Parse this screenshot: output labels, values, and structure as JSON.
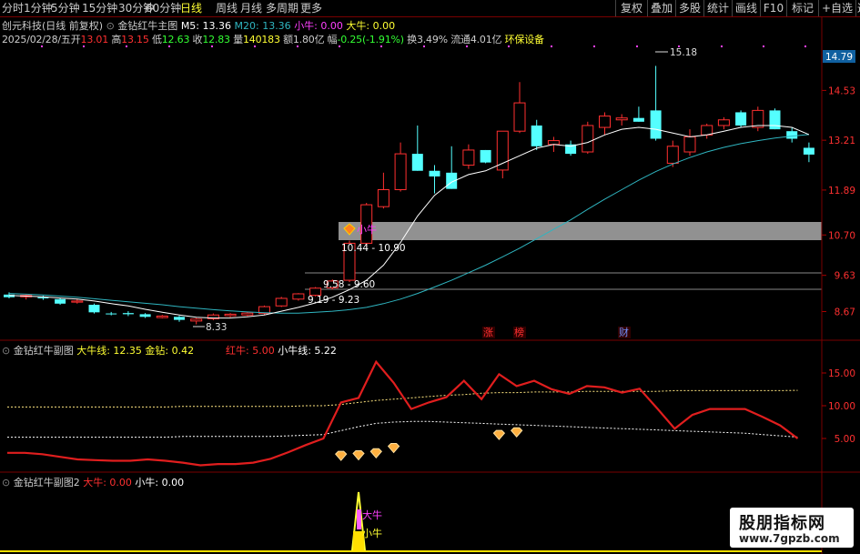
{
  "toolbar": {
    "periods": [
      "分时",
      "1分钟",
      "5分钟",
      "15分钟",
      "30分钟",
      "60分钟",
      "日线",
      "周线",
      "月线",
      "多周期",
      "更多"
    ],
    "active_period": "日线",
    "right_buttons": [
      "复权",
      "叠加",
      "多股",
      "统计",
      "画线",
      "F10",
      "标记",
      "+自选",
      "返回"
    ]
  },
  "main_header": {
    "stock": "创元科技(日线 前复权)",
    "indicator": "金钻红牛主图",
    "m5": "M5: 13.36",
    "m20": "M20: 13.36",
    "xiaoniu": "小牛: 0.00",
    "daniu": "大牛: 0.00"
  },
  "quote_line": {
    "date": "2025/02/28/五",
    "open_label": "开",
    "open": "13.01",
    "high_label": "高",
    "high": "13.15",
    "low_label": "低",
    "low": "12.63",
    "close_label": "收",
    "close": "12.83",
    "vol_label": "量",
    "vol": "140183",
    "amt_label": "额",
    "amt": "1.80亿",
    "chg_label": "幅",
    "chg": "-0.25(-1.91%)",
    "turn_label": "换",
    "turn": "3.49%",
    "float_label": "流通",
    "float": "4.01亿",
    "sector": "环保设备"
  },
  "sub1_header": {
    "name": "金钻红牛副图",
    "daniuxian": "大牛线: 12.35",
    "jinzuan": "金钻: 0.42",
    "hongniu": "红牛: 5.00",
    "xiaoniuxian": "小牛线: 5.22"
  },
  "sub2_header": {
    "name": "金钻红牛副图2",
    "daniu": "大牛: 0.00",
    "xiaoniu": "小牛: 0.00"
  },
  "annotations": {
    "high_price": "15.18",
    "low_price": "8.33",
    "band_top": "10.44 - 10.90",
    "band_mid": "9.58 - 9.60",
    "band_low": "9.19 - 9.23",
    "xiaoniu_signal": "小牛",
    "sub2_daniu": "大牛",
    "sub2_xiaoniu": "小牛",
    "events": [
      "涨",
      "榜",
      "财"
    ]
  },
  "watermark": {
    "brand": "股朋指标网",
    "url": "www.7gpzb.com"
  },
  "colors": {
    "up": "#ff3030",
    "down": "#54ffff",
    "ma5": "#ffffff",
    "ma20": "#2fb5c0",
    "red_line": "#e01e1e",
    "yellow": "#ffff33",
    "magenta": "#ff40ff"
  },
  "chart_data": [
    {
      "type": "candlestick",
      "title": "金钻红牛主图",
      "ylim": [
        8.2,
        15.6
      ],
      "y_ticks": [
        "14.53",
        "13.21",
        "11.89",
        "10.70",
        "9.63",
        "8.67"
      ],
      "current_price_tag": "14.79",
      "candles": [
        {
          "o": 9.12,
          "h": 9.18,
          "l": 9.02,
          "c": 9.05
        },
        {
          "o": 9.06,
          "h": 9.14,
          "l": 8.99,
          "c": 9.1
        },
        {
          "o": 9.05,
          "h": 9.09,
          "l": 8.98,
          "c": 9.02
        },
        {
          "o": 9.0,
          "h": 9.04,
          "l": 8.85,
          "c": 8.88
        },
        {
          "o": 8.92,
          "h": 9.0,
          "l": 8.88,
          "c": 8.95
        },
        {
          "o": 8.85,
          "h": 8.88,
          "l": 8.62,
          "c": 8.65
        },
        {
          "o": 8.62,
          "h": 8.66,
          "l": 8.57,
          "c": 8.6
        },
        {
          "o": 8.63,
          "h": 8.68,
          "l": 8.55,
          "c": 8.6
        },
        {
          "o": 8.6,
          "h": 8.63,
          "l": 8.5,
          "c": 8.53
        },
        {
          "o": 8.51,
          "h": 8.58,
          "l": 8.49,
          "c": 8.55
        },
        {
          "o": 8.53,
          "h": 8.56,
          "l": 8.4,
          "c": 8.45
        },
        {
          "o": 8.42,
          "h": 8.5,
          "l": 8.33,
          "c": 8.47
        },
        {
          "o": 8.48,
          "h": 8.62,
          "l": 8.44,
          "c": 8.58
        },
        {
          "o": 8.56,
          "h": 8.63,
          "l": 8.52,
          "c": 8.6
        },
        {
          "o": 8.58,
          "h": 8.66,
          "l": 8.55,
          "c": 8.63
        },
        {
          "o": 8.62,
          "h": 8.83,
          "l": 8.58,
          "c": 8.8
        },
        {
          "o": 8.82,
          "h": 9.06,
          "l": 8.79,
          "c": 9.02
        },
        {
          "o": 9.0,
          "h": 9.16,
          "l": 8.96,
          "c": 9.14
        },
        {
          "o": 9.1,
          "h": 9.32,
          "l": 9.07,
          "c": 9.29
        },
        {
          "o": 9.3,
          "h": 9.52,
          "l": 9.25,
          "c": 9.48
        },
        {
          "o": 9.5,
          "h": 10.55,
          "l": 9.45,
          "c": 10.48
        },
        {
          "o": 10.48,
          "h": 11.55,
          "l": 10.4,
          "c": 11.5
        },
        {
          "o": 11.45,
          "h": 12.35,
          "l": 11.4,
          "c": 11.9
        },
        {
          "o": 11.9,
          "h": 13.15,
          "l": 11.85,
          "c": 12.85
        },
        {
          "o": 12.85,
          "h": 13.6,
          "l": 12.45,
          "c": 12.4
        },
        {
          "o": 12.4,
          "h": 12.55,
          "l": 11.8,
          "c": 12.25
        },
        {
          "o": 12.35,
          "h": 13.05,
          "l": 12.2,
          "c": 11.92
        },
        {
          "o": 12.55,
          "h": 13.1,
          "l": 12.45,
          "c": 12.95
        },
        {
          "o": 12.95,
          "h": 12.62,
          "l": 12.6,
          "c": 12.62
        },
        {
          "o": 12.42,
          "h": 13.25,
          "l": 12.2,
          "c": 13.45
        },
        {
          "o": 13.45,
          "h": 14.75,
          "l": 13.4,
          "c": 14.2
        },
        {
          "o": 13.6,
          "h": 13.75,
          "l": 12.95,
          "c": 13.05
        },
        {
          "o": 13.1,
          "h": 13.3,
          "l": 12.9,
          "c": 13.2
        },
        {
          "o": 13.1,
          "h": 13.2,
          "l": 12.8,
          "c": 12.85
        },
        {
          "o": 12.9,
          "h": 13.7,
          "l": 12.85,
          "c": 13.6
        },
        {
          "o": 13.55,
          "h": 13.95,
          "l": 13.35,
          "c": 13.85
        },
        {
          "o": 13.75,
          "h": 13.9,
          "l": 13.6,
          "c": 13.8
        },
        {
          "o": 13.8,
          "h": 14.1,
          "l": 13.75,
          "c": 13.7
        },
        {
          "o": 14.0,
          "h": 15.18,
          "l": 13.2,
          "c": 13.25
        },
        {
          "o": 12.6,
          "h": 13.2,
          "l": 12.5,
          "c": 13.05
        },
        {
          "o": 12.9,
          "h": 13.5,
          "l": 12.8,
          "c": 13.3
        },
        {
          "o": 13.35,
          "h": 13.65,
          "l": 13.25,
          "c": 13.6
        },
        {
          "o": 13.6,
          "h": 13.82,
          "l": 13.5,
          "c": 13.75
        },
        {
          "o": 13.95,
          "h": 14.0,
          "l": 13.55,
          "c": 13.6
        },
        {
          "o": 13.55,
          "h": 14.1,
          "l": 13.45,
          "c": 14.0
        },
        {
          "o": 14.0,
          "h": 14.05,
          "l": 13.5,
          "c": 13.5
        },
        {
          "o": 13.45,
          "h": 13.55,
          "l": 13.15,
          "c": 13.25
        },
        {
          "o": 13.01,
          "h": 13.15,
          "l": 12.63,
          "c": 12.83
        }
      ],
      "ma5": [
        9.1,
        9.08,
        9.06,
        9.03,
        9.0,
        8.95,
        8.88,
        8.82,
        8.73,
        8.65,
        8.58,
        8.52,
        8.5,
        8.5,
        8.53,
        8.58,
        8.68,
        8.78,
        8.9,
        9.05,
        9.25,
        9.5,
        9.9,
        10.5,
        11.2,
        11.75,
        12.1,
        12.3,
        12.4,
        12.6,
        12.8,
        13.0,
        13.1,
        13.05,
        13.15,
        13.35,
        13.5,
        13.55,
        13.5,
        13.4,
        13.3,
        13.35,
        13.45,
        13.55,
        13.6,
        13.6,
        13.55,
        13.36
      ],
      "ma20": [
        9.15,
        9.13,
        9.11,
        9.08,
        9.05,
        9.01,
        8.97,
        8.93,
        8.89,
        8.85,
        8.8,
        8.76,
        8.72,
        8.69,
        8.66,
        8.64,
        8.63,
        8.63,
        8.65,
        8.68,
        8.72,
        8.78,
        8.88,
        9.0,
        9.15,
        9.32,
        9.5,
        9.7,
        9.9,
        10.12,
        10.35,
        10.6,
        10.85,
        11.1,
        11.38,
        11.65,
        11.9,
        12.15,
        12.38,
        12.58,
        12.75,
        12.9,
        13.02,
        13.12,
        13.2,
        13.27,
        13.32,
        13.36
      ]
    },
    {
      "type": "line",
      "title": "金钻红牛副图",
      "ylim": [
        0,
        17.5
      ],
      "y_ticks": [
        "15.00",
        "10.00",
        "5.00"
      ],
      "series": [
        {
          "name": "红牛",
          "values": [
            2.8,
            2.8,
            2.6,
            2.2,
            1.8,
            1.7,
            1.6,
            1.6,
            1.8,
            1.6,
            1.3,
            0.9,
            1.1,
            1.1,
            1.3,
            1.9,
            2.9,
            4.0,
            5.0,
            10.5,
            11.2,
            16.7,
            13.5,
            9.5,
            10.5,
            11.3,
            13.8,
            11.0,
            14.8,
            13.0,
            13.8,
            12.5,
            11.8,
            13.0,
            12.8,
            12.0,
            12.6,
            9.6,
            6.5,
            8.6,
            9.5,
            9.5,
            9.5,
            8.3,
            7.0,
            5.0
          ]
        },
        {
          "name": "大牛线",
          "values": [
            9.8,
            9.8,
            9.8,
            9.8,
            9.8,
            9.8,
            9.8,
            9.8,
            9.8,
            9.8,
            9.9,
            9.9,
            9.9,
            9.9,
            9.9,
            9.9,
            9.9,
            10.0,
            10.0,
            10.2,
            10.5,
            10.8,
            11.0,
            11.2,
            11.4,
            11.6,
            11.7,
            11.9,
            12.0,
            12.0,
            12.1,
            12.1,
            12.1,
            12.2,
            12.2,
            12.2,
            12.2,
            12.2,
            12.3,
            12.3,
            12.3,
            12.3,
            12.3,
            12.3,
            12.3,
            12.35
          ]
        },
        {
          "name": "小牛线",
          "values": [
            5.2,
            5.2,
            5.2,
            5.2,
            5.2,
            5.2,
            5.2,
            5.2,
            5.2,
            5.2,
            5.3,
            5.3,
            5.3,
            5.3,
            5.3,
            5.3,
            5.4,
            5.5,
            5.6,
            6.2,
            6.8,
            7.3,
            7.5,
            7.6,
            7.6,
            7.5,
            7.4,
            7.3,
            7.2,
            7.1,
            7.0,
            6.9,
            6.8,
            6.7,
            6.6,
            6.5,
            6.4,
            6.3,
            6.2,
            6.1,
            6.0,
            5.9,
            5.8,
            5.6,
            5.4,
            5.22
          ]
        }
      ],
      "jinzuan_markers": [
        {
          "i": 19,
          "y": 2.2
        },
        {
          "i": 20,
          "y": 2.3
        },
        {
          "i": 21,
          "y": 2.6
        },
        {
          "i": 22,
          "y": 3.4
        },
        {
          "i": 28,
          "y": 5.4
        },
        {
          "i": 29,
          "y": 5.8
        }
      ]
    },
    {
      "type": "bar",
      "title": "金钻红牛副图2",
      "series": [
        {
          "name": "大牛",
          "values": [
            {
              "i": 20,
              "v": 1
            }
          ]
        },
        {
          "name": "小牛",
          "values": [
            {
              "i": 20,
              "v": 1
            }
          ]
        }
      ]
    }
  ]
}
